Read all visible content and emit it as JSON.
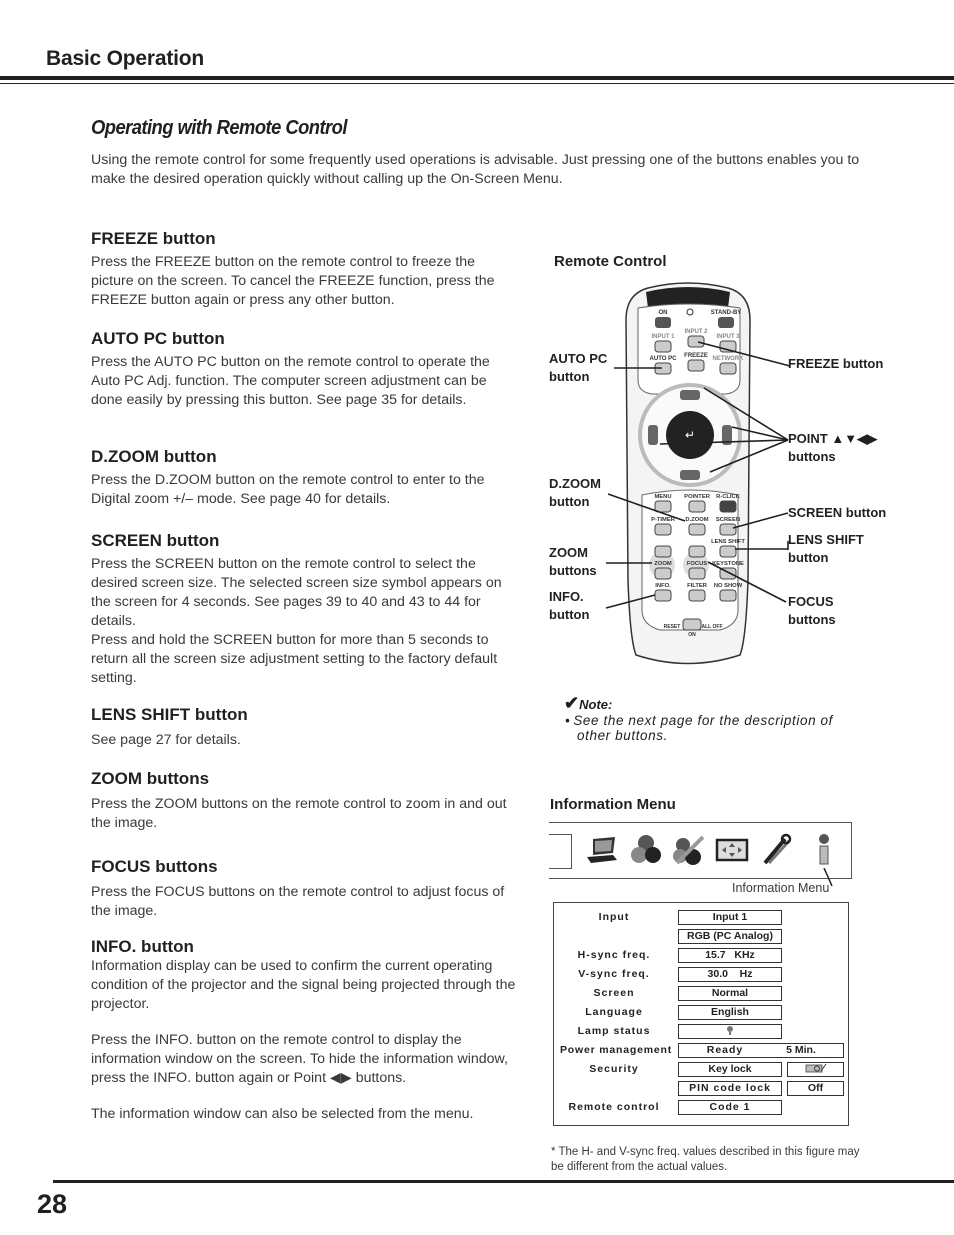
{
  "header": {
    "section": "Basic Operation"
  },
  "section_title": "Operating with Remote Control",
  "intro": "Using the remote control for some frequently used operations is advisable. Just pressing one of the buttons enables you to make the desired operation quickly without calling up the On-Screen Menu.",
  "items": [
    {
      "title": "FREEZE button",
      "paragraphs": [
        "Press the FREEZE button on the remote control to freeze the picture on the screen. To cancel the FREEZE function, press the FREEZE button again or press any other button."
      ]
    },
    {
      "title": "AUTO PC button",
      "paragraphs": [
        "Press the AUTO PC button on the remote control to operate the Auto PC Adj. function. The computer screen adjustment can be done easily by pressing this button. See page 35 for details."
      ]
    },
    {
      "title": "D.ZOOM button",
      "paragraphs": [
        "Press the D.ZOOM button on the remote control to enter to the Digital zoom +/– mode. See page 40 for details."
      ]
    },
    {
      "title": "SCREEN button",
      "paragraphs": [
        "Press the SCREEN button on the remote control to select the desired screen size. The selected screen size symbol appears on the screen for 4 seconds. See pages 39 to 40 and 43 to 44 for details.",
        "Press and hold the SCREEN button for more than 5 seconds to return all the screen size adjustment setting to the factory default setting."
      ]
    },
    {
      "title": "LENS SHIFT button",
      "paragraphs": [
        "See page 27 for details."
      ]
    },
    {
      "title": "ZOOM buttons",
      "paragraphs": [
        "Press the ZOOM buttons on the remote control to zoom in and out the image."
      ]
    },
    {
      "title": "FOCUS buttons",
      "paragraphs": [
        "Press the FOCUS buttons on the remote control to adjust focus of the image."
      ]
    },
    {
      "title": "INFO. button",
      "paragraphs": [
        "Information display can be used to confirm the current operating condition of the projector and the signal being projected through the projector.",
        "Press the INFO. button on the remote control to display the information window on the screen. To hide the information window, press the INFO. button again or Point ◀▶ buttons.",
        "The information window can also be selected from the menu."
      ]
    }
  ],
  "remote": {
    "title": "Remote Control",
    "callouts": {
      "auto_pc": [
        "AUTO PC",
        "button"
      ],
      "freeze": [
        "FREEZE button"
      ],
      "point": [
        "POINT ▲▼◀▶",
        "buttons"
      ],
      "dzoom": [
        "D.ZOOM",
        "button"
      ],
      "screen": [
        "SCREEN button"
      ],
      "lens_shift": [
        "LENS SHIFT",
        "button"
      ],
      "zoom": [
        "ZOOM",
        "buttons"
      ],
      "info": [
        "INFO.",
        "button"
      ],
      "focus": [
        "FOCUS",
        "buttons"
      ]
    },
    "button_labels": {
      "on": "ON",
      "standby": "STAND-BY",
      "input1": "INPUT 1",
      "input2": "INPUT 2",
      "input3": "INPUT 3",
      "autopc": "AUTO PC",
      "freeze": "FREEZE",
      "network": "NETWORK",
      "menu": "MENU",
      "pointer": "POINTER",
      "rclick": "R-CLICK",
      "ptimer": "P-TIMER",
      "dzoom": "D.ZOOM",
      "screen": "SCREEN",
      "lensshift": "LENS SHIFT",
      "zoom": "ZOOM",
      "focus": "FOCUS",
      "keystone": "KEYSTONE",
      "info": "INFO.",
      "filter": "FILTER",
      "noshow": "NO SHOW",
      "reset": "RESET",
      "alloff": "ALL OFF",
      "switch_on": "ON"
    }
  },
  "note": {
    "title": "Note:",
    "bullets": [
      "See the next page for the description of other buttons."
    ]
  },
  "info_menu": {
    "title": "Information  Menu",
    "icons": [
      "input-menu-icon",
      "pc-adjust-icon",
      "color-icon",
      "image-icon",
      "screen-icon",
      "setting-icon",
      "information-icon"
    ],
    "caption": "Information Menu",
    "rows": [
      {
        "label": "Input",
        "value": "Input 1"
      },
      {
        "label": "",
        "value": "RGB (PC Analog)"
      },
      {
        "label": "H-sync freq.",
        "value": "15.7   KHz"
      },
      {
        "label": "V-sync freq.",
        "value": "30.0    Hz"
      },
      {
        "label": "Screen",
        "value": "Normal"
      },
      {
        "label": "Language",
        "value": "English"
      },
      {
        "label": "Lamp status",
        "value": "lamp-icon"
      },
      {
        "label": "Power management",
        "value": "Ready",
        "extra": "5 Min."
      },
      {
        "label": "Security",
        "value": "Key lock",
        "extra": "key-lock-icon"
      },
      {
        "label": "",
        "value": "PIN code lock",
        "extra": "Off"
      },
      {
        "label": "Remote control",
        "value": "Code 1"
      }
    ],
    "footnote": "* The H- and V-sync freq. values described in this figure may be different from the actual values."
  },
  "page_number": "28"
}
